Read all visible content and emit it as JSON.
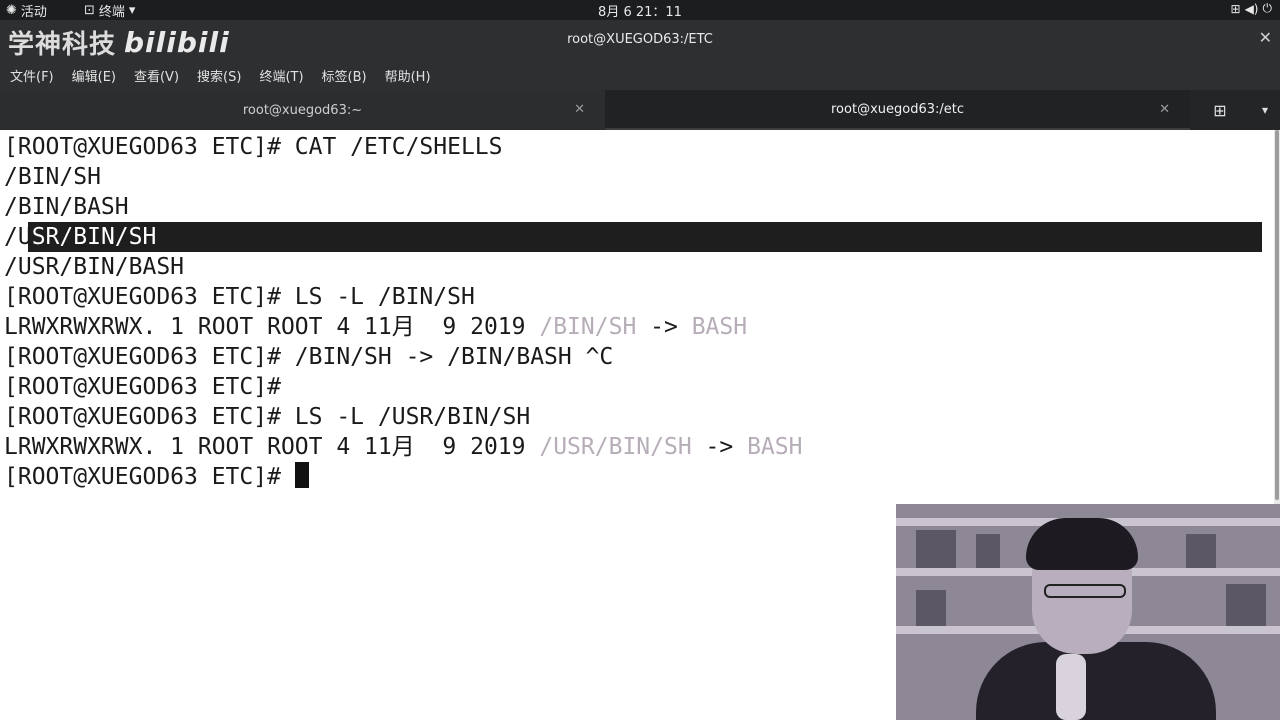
{
  "topbar": {
    "activities": "活动",
    "app_menu": "终端",
    "clock": "8月 6  21：11"
  },
  "window": {
    "title": "root@XUEGOD63:/ETC",
    "watermark_cn": "学神科技",
    "watermark_brand": "bilibili"
  },
  "menubar": {
    "items": [
      "文件(F)",
      "编辑(E)",
      "查看(V)",
      "搜索(S)",
      "终端(T)",
      "标签(B)",
      "帮助(H)"
    ]
  },
  "tabs": [
    {
      "label": "root@xuegod63:~"
    },
    {
      "label": "root@xuegod63:/etc"
    }
  ],
  "terminal": {
    "lines": [
      {
        "text": "[ROOT@XUEGOD63 ETC]# CAT /ETC/SHELLS"
      },
      {
        "text": "/BIN/SH"
      },
      {
        "text": "/BIN/BASH"
      },
      {
        "pre": "/U",
        "sel": "SR/BIN/SH"
      },
      {
        "text": "/USR/BIN/BASH"
      },
      {
        "text": "[ROOT@XUEGOD63 ETC]# LS -L /BIN/SH"
      },
      {
        "pre": "LRWXRWXRWX. 1 ROOT ROOT 4 11月  9 2019 ",
        "link": "/BIN/SH",
        "arrow": " -> ",
        "target": "BASH"
      },
      {
        "text": "[ROOT@XUEGOD63 ETC]# /BIN/SH -> /BIN/BASH ^C"
      },
      {
        "text": "[ROOT@XUEGOD63 ETC]#"
      },
      {
        "text": "[ROOT@XUEGOD63 ETC]# LS -L /USR/BIN/SH"
      },
      {
        "pre": "LRWXRWXRWX. 1 ROOT ROOT 4 11月  9 2019 ",
        "link": "/USR/BIN/SH",
        "arrow": " -> ",
        "target": "BASH"
      },
      {
        "text": "[ROOT@XUEGOD63 ETC]# "
      }
    ]
  },
  "colors": {
    "terminal_bg": "#ffffff",
    "terminal_fg": "#1a1a1a",
    "symlink_dim": "#b7adb9",
    "chrome_dark": "#2d2f31"
  }
}
